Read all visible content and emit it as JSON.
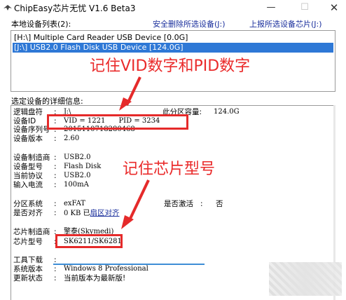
{
  "window": {
    "title": "ChipEasy芯片无忧 V1.6 Beta3",
    "min_glyph": "—",
    "max_glyph": "☐",
    "close_glyph": "✕"
  },
  "toolbar": {
    "devices_label": "本地设备列表(2):",
    "remove_link": "安全删除所选设备(J:)",
    "report_link": "上报所选设备芯片(J:)"
  },
  "devices": [
    {
      "text": "[H:\\] Multiple Card  Reader USB Device [0.0G]"
    },
    {
      "text": "[J:\\] USB2.0 Flash Disk USB Device [124.0G]"
    }
  ],
  "details_label": "选定设备的详细信息:",
  "details": {
    "drive_label": "逻辑盘符",
    "drive_value": "J:\\",
    "capacity_label": "此分区容量:",
    "capacity_value": "124.0G",
    "devid_label": "设备ID",
    "devid_value": "VID = 1221      PID = 3234",
    "serial_label": "设备序列号",
    "serial_value": "2015110718280468",
    "version_label": "设备版本",
    "version_value": "2.60",
    "vendor_label": "设备制造商",
    "vendor_value": "USB2.0",
    "model_label": "设备型号",
    "model_value": "Flash Disk",
    "protocol_label": "当前协议",
    "protocol_value": "USB2.0",
    "current_label": "输入电流",
    "current_value": "100mA",
    "fs_label": "分区系统",
    "fs_value": "exFAT",
    "activated_label": "是否激活",
    "activated_value": "否",
    "aligned_label": "是否对齐",
    "aligned_value_prefix": "0 KB 已",
    "aligned_link": "扇区对齐",
    "chipmaker_label": "芯片制造商",
    "chipmaker_value": "擎泰(Skymedi)",
    "chipmodel_label": "芯片型号",
    "chipmodel_value": "SK6211/SK6281",
    "tools_label": "工具下载",
    "os_label": "系统版本",
    "os_value": "Windows 8 Professional",
    "update_label": "更新状态",
    "update_value": "当前版本为最新版!"
  },
  "annotations": {
    "note_ids": "记住VID数字和PID数字",
    "note_chip": "记住芯片型号",
    "color": "#e52a2a"
  },
  "colors": {
    "selection": "#2e78d6",
    "link": "#1a2f9c",
    "progress": "#3e8ed6"
  }
}
